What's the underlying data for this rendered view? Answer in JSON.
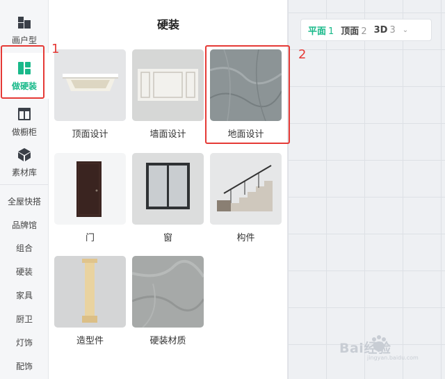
{
  "rail": {
    "items": [
      {
        "label": "画户型"
      },
      {
        "label": "做硬装"
      },
      {
        "label": "做橱柜"
      },
      {
        "label": "素材库"
      }
    ],
    "text_items": [
      "全屋快搭",
      "品牌馆",
      "组合",
      "硬装",
      "家具",
      "厨卫",
      "灯饰",
      "配饰"
    ]
  },
  "panel": {
    "title": "硬装",
    "cards": [
      {
        "label": "顶面设计"
      },
      {
        "label": "墙面设计"
      },
      {
        "label": "地面设计"
      },
      {
        "label": "门"
      },
      {
        "label": "窗"
      },
      {
        "label": "构件"
      },
      {
        "label": "造型件"
      },
      {
        "label": "硬装材质"
      }
    ]
  },
  "viewbar": {
    "items": [
      {
        "label": "平面",
        "num": "1",
        "active": true
      },
      {
        "label": "顶面",
        "num": "2",
        "active": false
      },
      {
        "label": "3D",
        "num": "3",
        "active": false
      }
    ]
  },
  "annotations": {
    "first": "1",
    "second": "2"
  },
  "watermark": {
    "text": "Bai经验",
    "sub": "jingyan.baidu.com"
  },
  "colors": {
    "accent": "#19b98a",
    "annotation": "#e53935",
    "canvas": "#eef0f3"
  }
}
